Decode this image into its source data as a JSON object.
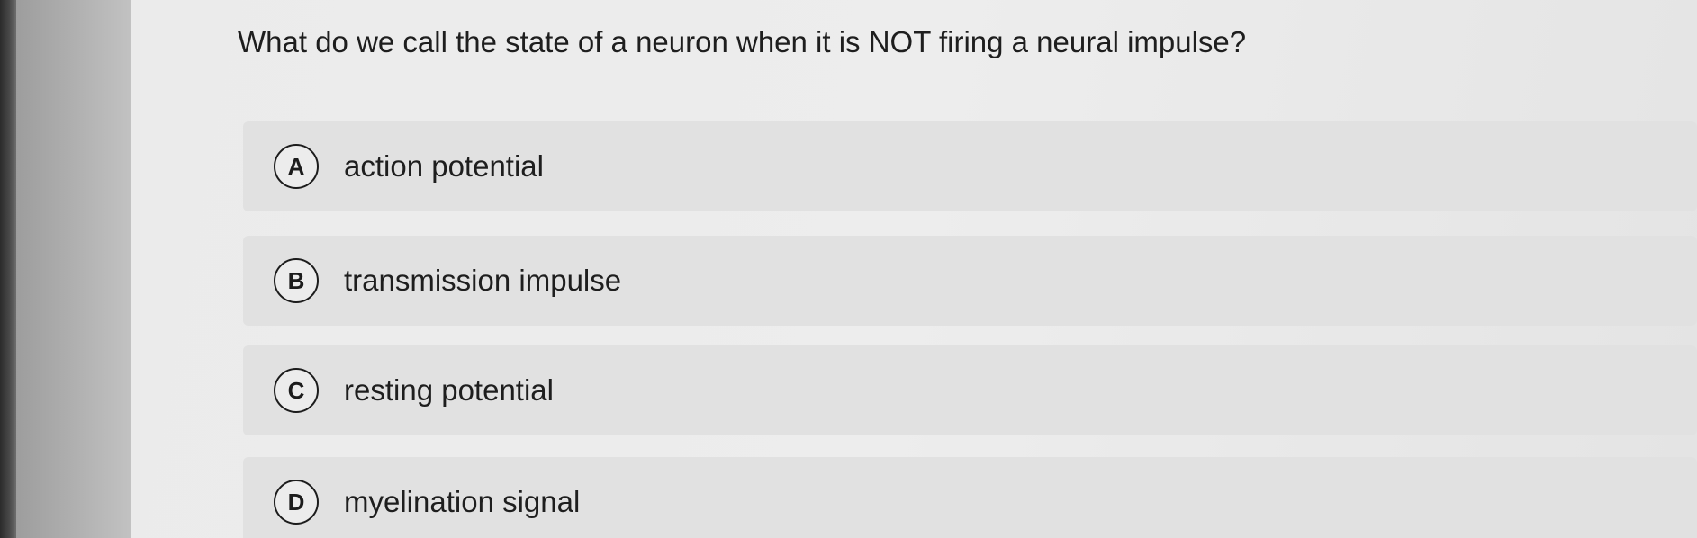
{
  "question": {
    "text": "What do we call the state of a neuron when it is NOT firing a neural impulse?"
  },
  "options": [
    {
      "letter": "A",
      "label": "action potential"
    },
    {
      "letter": "B",
      "label": "transmission impulse"
    },
    {
      "letter": "C",
      "label": "resting potential"
    },
    {
      "letter": "D",
      "label": "myelination signal"
    }
  ]
}
